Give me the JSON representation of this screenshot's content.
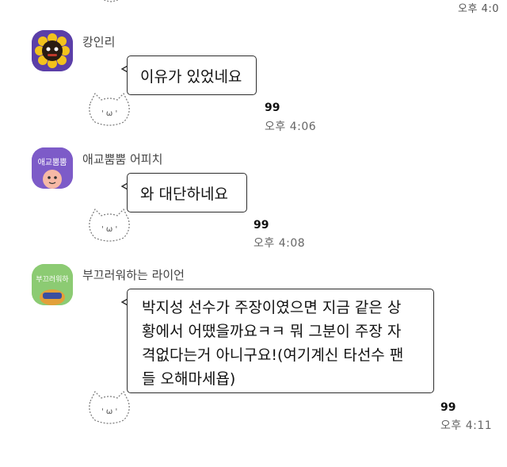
{
  "chat": {
    "top_time": "오후 4:0",
    "messages": [
      {
        "sender": "캉인리",
        "avatar_icon": "black-character-sunflower-avatar-icon",
        "text": "이유가 있었네요",
        "read_count": "99",
        "time": "오후 4:06",
        "sticker": "doodle-cat-sticker-icon"
      },
      {
        "sender": "애교뿜뿜 어피치",
        "avatar_icon": "apeach-aegyo-avatar-icon",
        "avatar_text": "애교뿜뿜",
        "text": "와 대단하네요",
        "read_count": "99",
        "time": "오후 4:08",
        "sticker": "doodle-cat-sticker-icon"
      },
      {
        "sender": "부끄러워하는 라이언",
        "avatar_icon": "shy-ryan-avatar-icon",
        "avatar_text": "부끄러워하",
        "text": "박지성 선수가 주장이였으면 지금 같은 상\n황에서 어땠을까요ㅋㅋ 뭐 그분이 주장 자\n격없다는거 아니구요!(여기계신 타선수 팬\n들 오해마세욥)",
        "read_count": "99",
        "time": "오후 4:11",
        "sticker": "doodle-cat-sticker-icon"
      }
    ]
  }
}
